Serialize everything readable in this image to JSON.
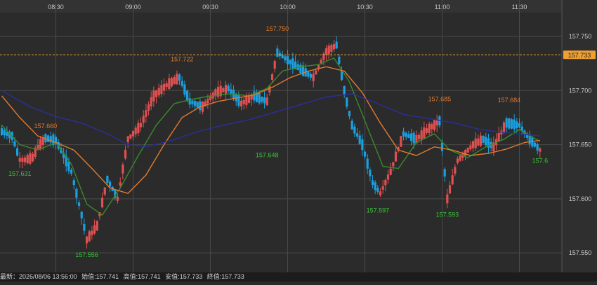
{
  "chart_data": {
    "type": "candlestick",
    "x_ticks": [
      "08:30",
      "09:00",
      "09:30",
      "10:00",
      "10:30",
      "11:00",
      "11:30"
    ],
    "y_ticks": [
      "157.750",
      "157.700",
      "157.650",
      "157.600",
      "157.550"
    ],
    "ylim": [
      157.532,
      157.772
    ],
    "current_price": "157.733",
    "current_price_value": 157.733,
    "grid": true,
    "annotations": [
      {
        "text": "157.631",
        "time": "08:16",
        "price": 157.631,
        "kind": "low"
      },
      {
        "text": "157.660",
        "time": "08:26",
        "price": 157.66,
        "kind": "high"
      },
      {
        "text": "157.556",
        "time": "08:42",
        "price": 157.556,
        "kind": "low"
      },
      {
        "text": "157.722",
        "time": "09:19",
        "price": 157.722,
        "kind": "high"
      },
      {
        "text": "157.648",
        "time": "09:52",
        "price": 157.648,
        "kind": "low"
      },
      {
        "text": "157.750",
        "time": "09:56",
        "price": 157.75,
        "kind": "high"
      },
      {
        "text": "157.597",
        "time": "10:35",
        "price": 157.597,
        "kind": "low"
      },
      {
        "text": "157.685",
        "time": "10:59",
        "price": 157.685,
        "kind": "high"
      },
      {
        "text": "157.593",
        "time": "11:02",
        "price": 157.593,
        "kind": "low"
      },
      {
        "text": "157.684",
        "time": "11:26",
        "price": 157.684,
        "kind": "high"
      },
      {
        "text": "157.6",
        "time": "11:38",
        "price": 157.643,
        "kind": "low"
      }
    ],
    "price_path": [
      {
        "time": "08:09",
        "price": 157.662
      },
      {
        "time": "08:13",
        "price": 157.658
      },
      {
        "time": "08:16",
        "price": 157.636
      },
      {
        "time": "08:18",
        "price": 157.636
      },
      {
        "time": "08:21",
        "price": 157.638
      },
      {
        "time": "08:23",
        "price": 157.648
      },
      {
        "time": "08:26",
        "price": 157.656
      },
      {
        "time": "08:30",
        "price": 157.654
      },
      {
        "time": "08:33",
        "price": 157.64
      },
      {
        "time": "08:36",
        "price": 157.625
      },
      {
        "time": "08:40",
        "price": 157.585
      },
      {
        "time": "08:42",
        "price": 157.562
      },
      {
        "time": "08:46",
        "price": 157.575
      },
      {
        "time": "08:50",
        "price": 157.618
      },
      {
        "time": "08:54",
        "price": 157.6
      },
      {
        "time": "08:58",
        "price": 157.655
      },
      {
        "time": "09:03",
        "price": 157.668
      },
      {
        "time": "09:08",
        "price": 157.695
      },
      {
        "time": "09:13",
        "price": 157.705
      },
      {
        "time": "09:18",
        "price": 157.712
      },
      {
        "time": "09:22",
        "price": 157.69
      },
      {
        "time": "09:27",
        "price": 157.685
      },
      {
        "time": "09:32",
        "price": 157.698
      },
      {
        "time": "09:37",
        "price": 157.702
      },
      {
        "time": "09:42",
        "price": 157.688
      },
      {
        "time": "09:47",
        "price": 157.695
      },
      {
        "time": "09:52",
        "price": 157.69
      },
      {
        "time": "09:56",
        "price": 157.735
      },
      {
        "time": "10:00",
        "price": 157.728
      },
      {
        "time": "10:05",
        "price": 157.72
      },
      {
        "time": "10:10",
        "price": 157.712
      },
      {
        "time": "10:15",
        "price": 157.736
      },
      {
        "time": "10:19",
        "price": 157.742
      },
      {
        "time": "10:22",
        "price": 157.7
      },
      {
        "time": "10:25",
        "price": 157.668
      },
      {
        "time": "10:29",
        "price": 157.65
      },
      {
        "time": "10:33",
        "price": 157.615
      },
      {
        "time": "10:36",
        "price": 157.605
      },
      {
        "time": "10:40",
        "price": 157.625
      },
      {
        "time": "10:45",
        "price": 157.66
      },
      {
        "time": "10:50",
        "price": 157.655
      },
      {
        "time": "10:55",
        "price": 157.665
      },
      {
        "time": "10:59",
        "price": 157.672
      },
      {
        "time": "11:02",
        "price": 157.6
      },
      {
        "time": "11:06",
        "price": 157.635
      },
      {
        "time": "11:12",
        "price": 157.65
      },
      {
        "time": "11:16",
        "price": 157.655
      },
      {
        "time": "11:20",
        "price": 157.648
      },
      {
        "time": "11:25",
        "price": 157.67
      },
      {
        "time": "11:30",
        "price": 157.668
      },
      {
        "time": "11:34",
        "price": 157.655
      },
      {
        "time": "11:38",
        "price": 157.645
      }
    ],
    "series": [
      {
        "color": "#3a8a2a",
        "points": [
          {
            "time": "08:09",
            "price": 157.668
          },
          {
            "time": "08:16",
            "price": 157.65
          },
          {
            "time": "08:23",
            "price": 157.645
          },
          {
            "time": "08:30",
            "price": 157.652
          },
          {
            "time": "08:36",
            "price": 157.632
          },
          {
            "time": "08:42",
            "price": 157.595
          },
          {
            "time": "08:48",
            "price": 157.585
          },
          {
            "time": "08:55",
            "price": 157.61
          },
          {
            "time": "09:02",
            "price": 157.64
          },
          {
            "time": "09:09",
            "price": 157.668
          },
          {
            "time": "09:16",
            "price": 157.688
          },
          {
            "time": "09:23",
            "price": 157.692
          },
          {
            "time": "09:30",
            "price": 157.695
          },
          {
            "time": "09:38",
            "price": 157.697
          },
          {
            "time": "09:45",
            "price": 157.695
          },
          {
            "time": "09:52",
            "price": 157.702
          },
          {
            "time": "09:58",
            "price": 157.718
          },
          {
            "time": "10:05",
            "price": 157.722
          },
          {
            "time": "10:12",
            "price": 157.724
          },
          {
            "time": "10:18",
            "price": 157.73
          },
          {
            "time": "10:24",
            "price": 157.708
          },
          {
            "time": "10:30",
            "price": 157.672
          },
          {
            "time": "10:37",
            "price": 157.63
          },
          {
            "time": "10:43",
            "price": 157.628
          },
          {
            "time": "10:50",
            "price": 157.652
          },
          {
            "time": "10:57",
            "price": 157.66
          },
          {
            "time": "11:03",
            "price": 157.645
          },
          {
            "time": "11:10",
            "price": 157.638
          },
          {
            "time": "11:17",
            "price": 157.648
          },
          {
            "time": "11:24",
            "price": 157.655
          },
          {
            "time": "11:30",
            "price": 157.664
          },
          {
            "time": "11:38",
            "price": 157.653
          }
        ]
      },
      {
        "color": "#e07a30",
        "points": [
          {
            "time": "08:09",
            "price": 157.695
          },
          {
            "time": "08:16",
            "price": 157.675
          },
          {
            "time": "08:23",
            "price": 157.658
          },
          {
            "time": "08:30",
            "price": 157.652
          },
          {
            "time": "08:37",
            "price": 157.645
          },
          {
            "time": "08:44",
            "price": 157.628
          },
          {
            "time": "08:51",
            "price": 157.61
          },
          {
            "time": "08:58",
            "price": 157.605
          },
          {
            "time": "09:05",
            "price": 157.622
          },
          {
            "time": "09:12",
            "price": 157.65
          },
          {
            "time": "09:19",
            "price": 157.675
          },
          {
            "time": "09:26",
            "price": 157.685
          },
          {
            "time": "09:33",
            "price": 157.69
          },
          {
            "time": "09:40",
            "price": 157.693
          },
          {
            "time": "09:47",
            "price": 157.696
          },
          {
            "time": "09:54",
            "price": 157.703
          },
          {
            "time": "10:01",
            "price": 157.712
          },
          {
            "time": "10:08",
            "price": 157.718
          },
          {
            "time": "10:15",
            "price": 157.722
          },
          {
            "time": "10:22",
            "price": 157.718
          },
          {
            "time": "10:29",
            "price": 157.698
          },
          {
            "time": "10:36",
            "price": 157.67
          },
          {
            "time": "10:43",
            "price": 157.645
          },
          {
            "time": "10:50",
            "price": 157.64
          },
          {
            "time": "10:57",
            "price": 157.648
          },
          {
            "time": "11:04",
            "price": 157.645
          },
          {
            "time": "11:11",
            "price": 157.64
          },
          {
            "time": "11:18",
            "price": 157.642
          },
          {
            "time": "11:25",
            "price": 157.646
          },
          {
            "time": "11:32",
            "price": 157.652
          },
          {
            "time": "11:38",
            "price": 157.654
          }
        ]
      },
      {
        "color": "#2a2f9c",
        "points": [
          {
            "time": "08:09",
            "price": 157.7
          },
          {
            "time": "08:20",
            "price": 157.685
          },
          {
            "time": "08:30",
            "price": 157.676
          },
          {
            "time": "08:40",
            "price": 157.67
          },
          {
            "time": "08:50",
            "price": 157.66
          },
          {
            "time": "08:58",
            "price": 157.65
          },
          {
            "time": "09:05",
            "price": 157.648
          },
          {
            "time": "09:15",
            "price": 157.654
          },
          {
            "time": "09:25",
            "price": 157.662
          },
          {
            "time": "09:35",
            "price": 157.668
          },
          {
            "time": "09:45",
            "price": 157.673
          },
          {
            "time": "09:55",
            "price": 157.68
          },
          {
            "time": "10:05",
            "price": 157.687
          },
          {
            "time": "10:15",
            "price": 157.694
          },
          {
            "time": "10:25",
            "price": 157.697
          },
          {
            "time": "10:35",
            "price": 157.688
          },
          {
            "time": "10:45",
            "price": 157.678
          },
          {
            "time": "10:55",
            "price": 157.674
          },
          {
            "time": "11:05",
            "price": 157.67
          },
          {
            "time": "11:15",
            "price": 157.664
          },
          {
            "time": "11:25",
            "price": 157.661
          },
          {
            "time": "11:38",
            "price": 157.658
          }
        ]
      }
    ]
  },
  "status_bar": {
    "latest": "最新：2026/08/06 13:56:00",
    "open": "始值:157.741",
    "high": "高值:157.741",
    "low": "安值:157.733",
    "close": "終值:157.733"
  },
  "colors": {
    "background": "#2b2b2b",
    "grid": "#4a4a4a",
    "up_candle": "#e05050",
    "down_candle": "#1aa0e0",
    "high_label": "#e07a30",
    "low_label": "#3ac43a",
    "current_price_line": "#f0a030"
  }
}
